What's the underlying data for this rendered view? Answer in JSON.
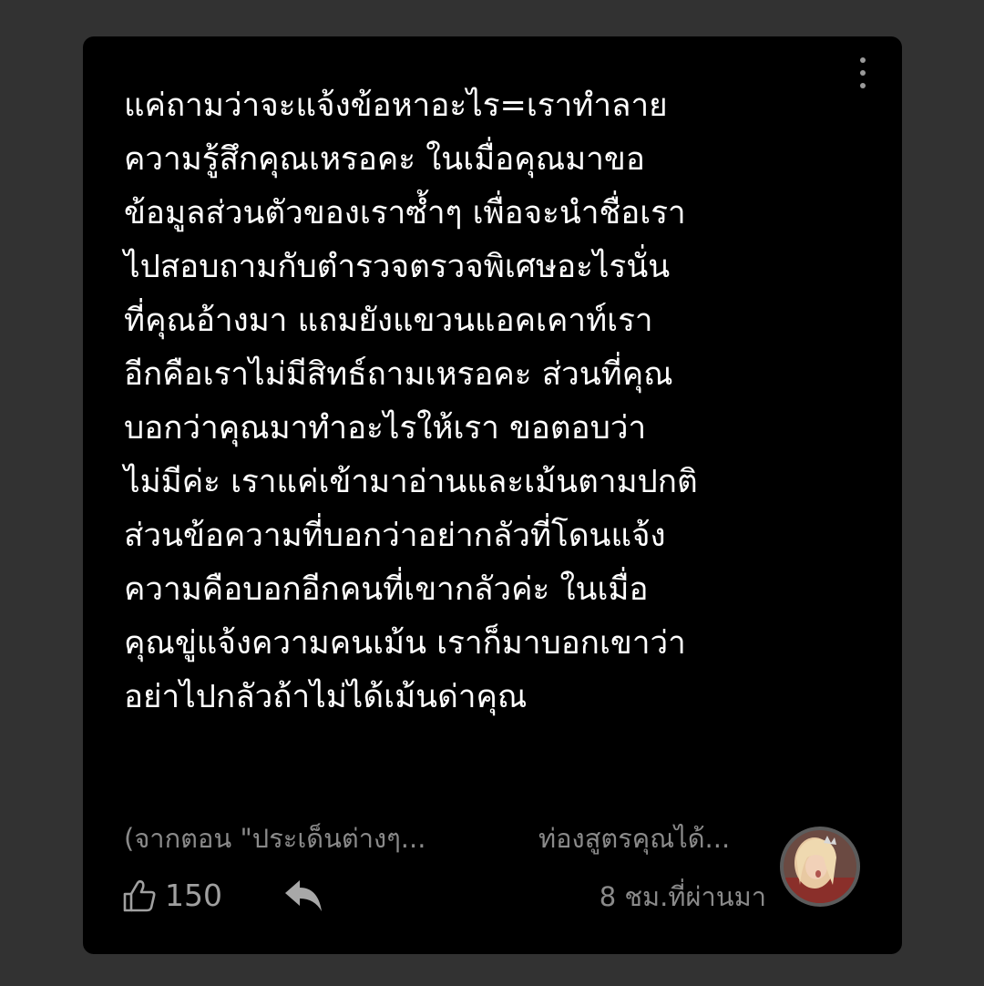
{
  "comment": {
    "lines": [
      "แค่ถามว่าจะแจ้งข้อหาอะไร=เราทำลาย",
      "ความรู้สึกคุณเหรอคะ ในเมื่อคุณมาขอ",
      "ข้อมูลส่วนตัวของเราซ้ำๆ เพื่อจะนำชื่อเรา",
      "ไปสอบถามกับตำรวจตรวจพิเศษอะไรนั่น",
      "ที่คุณอ้างมา แถมยังแขวนแอคเคาท์เรา",
      "อีกคือเราไม่มีสิทธ์ถามเหรอคะ ส่วนที่คุณ",
      "บอกว่าคุณมาทำอะไรให้เรา ขอตอบว่า",
      "ไม่มีค่ะ เราแค่เข้ามาอ่านและเม้นตามปกติ",
      "ส่วนข้อความที่บอกว่าอย่ากลัวที่โดนแจ้ง",
      "ความคือบอกอีกคนที่เขากลัวค่ะ ในเมื่อ",
      "คุณขู่แจ้งความคนเม้น เราก็มาบอกเขาว่า",
      "อย่าไปกลัวถ้าไม่ได้เม้นด่าคุณ"
    ]
  },
  "footer": {
    "source": "(จากตอน \"ประเด็นต่างๆ...",
    "author": "ท่องสูตรคุณได้...",
    "like_count": "150",
    "timestamp": "8 ชม.ที่ผ่านมา"
  },
  "icons": {
    "more": "more-vertical-icon",
    "like": "thumbs-up-icon",
    "reply": "reply-arrow-icon",
    "avatar": "user-avatar"
  },
  "colors": {
    "background": "#323232",
    "card": "#000000",
    "text": "#ffffff",
    "muted": "#8a8a8a"
  }
}
